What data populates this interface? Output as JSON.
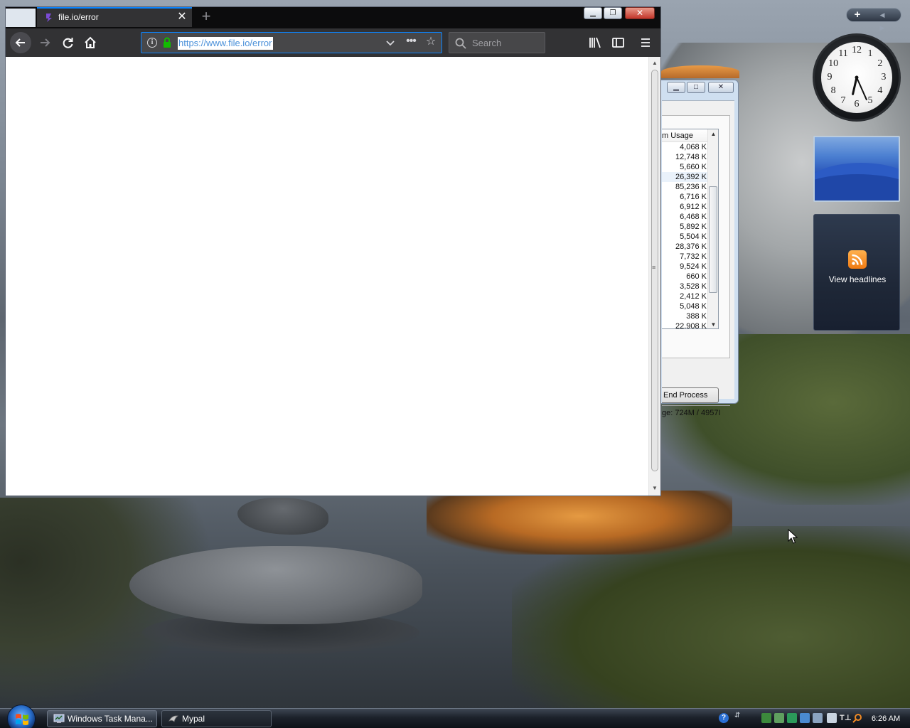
{
  "browser": {
    "tab_title": "file.io/error",
    "tab_close": "✕",
    "new_tab": "+",
    "url": "https://www.file.io/error",
    "search_placeholder": "Search",
    "window_buttons": {
      "minimize": "—",
      "maximize": "❐",
      "close": "✕"
    }
  },
  "task_manager": {
    "column_header": "m Usage",
    "memory_values": [
      "4,068 K",
      "12,748 K",
      "5,660 K",
      "26,392 K",
      "85,236 K",
      "6,716 K",
      "6,912 K",
      "6,468 K",
      "5,892 K",
      "5,504 K",
      "28,376 K",
      "7,732 K",
      "9,524 K",
      "660 K",
      "3,528 K",
      "2,412 K",
      "5,048 K",
      "388 K",
      "22,908 K"
    ],
    "end_process_label": "End Process",
    "status_text": "ge: 724M / 4957I"
  },
  "gadgets": {
    "clock_numbers": [
      "12",
      "1",
      "2",
      "3",
      "4",
      "5",
      "6",
      "7",
      "8",
      "9",
      "10",
      "11"
    ],
    "feed_label": "View headlines",
    "control_plus": "+",
    "control_arrows": "◀ ▶"
  },
  "taskbar": {
    "items": [
      {
        "label": "Windows Task Mana...",
        "active": false
      },
      {
        "label": "Mypal",
        "active": true
      }
    ],
    "clock": "6:26 AM"
  },
  "colors": {
    "firefox_dark": "#323234",
    "accent_blue": "#0a84ff",
    "secure_green": "#12bc00"
  }
}
